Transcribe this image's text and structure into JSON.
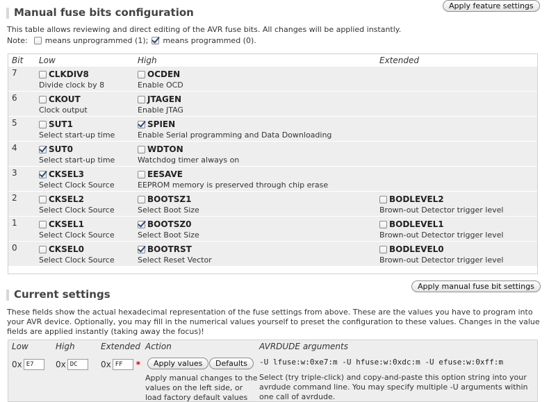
{
  "manual": {
    "title": "Manual fuse bits configuration",
    "apply_feature_button": "Apply feature settings",
    "description": "This table allows reviewing and direct editing of the AVR fuse bits. All changes will be applied instantly.",
    "note_label": "Note:",
    "note_unprogrammed": "means unprogrammed (1);",
    "note_programmed": "means programmed (0).",
    "columns": {
      "bit": "Bit",
      "low": "Low",
      "high": "High",
      "extended": "Extended"
    },
    "rows": [
      {
        "bit": "7",
        "low": {
          "name": "CLKDIV8",
          "checked": false,
          "desc": "Divide clock by 8"
        },
        "high": {
          "name": "OCDEN",
          "checked": false,
          "desc": "Enable OCD"
        }
      },
      {
        "bit": "6",
        "low": {
          "name": "CKOUT",
          "checked": false,
          "desc": "Clock output"
        },
        "high": {
          "name": "JTAGEN",
          "checked": false,
          "desc": "Enable JTAG"
        }
      },
      {
        "bit": "5",
        "low": {
          "name": "SUT1",
          "checked": false,
          "desc": "Select start-up time"
        },
        "high": {
          "name": "SPIEN",
          "checked": true,
          "desc": "Enable Serial programming and Data Downloading"
        }
      },
      {
        "bit": "4",
        "low": {
          "name": "SUT0",
          "checked": true,
          "desc": "Select start-up time"
        },
        "high": {
          "name": "WDTON",
          "checked": false,
          "desc": "Watchdog timer always on"
        }
      },
      {
        "bit": "3",
        "low": {
          "name": "CKSEL3",
          "checked": true,
          "desc": "Select Clock Source"
        },
        "high": {
          "name": "EESAVE",
          "checked": false,
          "desc": "EEPROM memory is preserved through chip erase"
        }
      },
      {
        "bit": "2",
        "low": {
          "name": "CKSEL2",
          "checked": false,
          "desc": "Select Clock Source"
        },
        "high": {
          "name": "BOOTSZ1",
          "checked": false,
          "desc": "Select Boot Size"
        },
        "ext": {
          "name": "BODLEVEL2",
          "checked": false,
          "desc": "Brown-out Detector trigger level"
        }
      },
      {
        "bit": "1",
        "low": {
          "name": "CKSEL1",
          "checked": false,
          "desc": "Select Clock Source"
        },
        "high": {
          "name": "BOOTSZ0",
          "checked": true,
          "desc": "Select Boot Size"
        },
        "ext": {
          "name": "BODLEVEL1",
          "checked": false,
          "desc": "Brown-out Detector trigger level"
        }
      },
      {
        "bit": "0",
        "low": {
          "name": "CKSEL0",
          "checked": false,
          "desc": "Select Clock Source"
        },
        "high": {
          "name": "BOOTRST",
          "checked": true,
          "desc": "Select Reset Vector"
        },
        "ext": {
          "name": "BODLEVEL0",
          "checked": false,
          "desc": "Brown-out Detector trigger level"
        }
      }
    ],
    "apply_manual_button": "Apply manual fuse bit settings"
  },
  "current": {
    "title": "Current settings",
    "description": "These fields show the actual hexadecimal representation of the fuse settings from above. These are the values you have to program into your AVR device. Optionally, you may fill in the numerical values yourself to preset the configuration to these values. Changes in the value fields are applied instantly (taking away the focus)!",
    "headers": {
      "low": "Low",
      "high": "High",
      "extended": "Extended",
      "action": "Action",
      "avrdude": "AVRDUDE arguments"
    },
    "hex_prefix": "0x",
    "low_value": "E7",
    "high_value": "DC",
    "ext_value": "FF",
    "required_mark": "*",
    "apply_values_button": "Apply values",
    "defaults_button": "Defaults",
    "action_help": "Apply manual changes to the values on the left side, or load factory default values for the",
    "avrdude_args": "-U lfuse:w:0xe7:m -U hfuse:w:0xdc:m -U efuse:w:0xff:m",
    "avrdude_help": "Select (try triple-click) and copy-and-paste this option string into your avrdude command line. You may specify multiple -U arguments within one call of avrdude."
  }
}
